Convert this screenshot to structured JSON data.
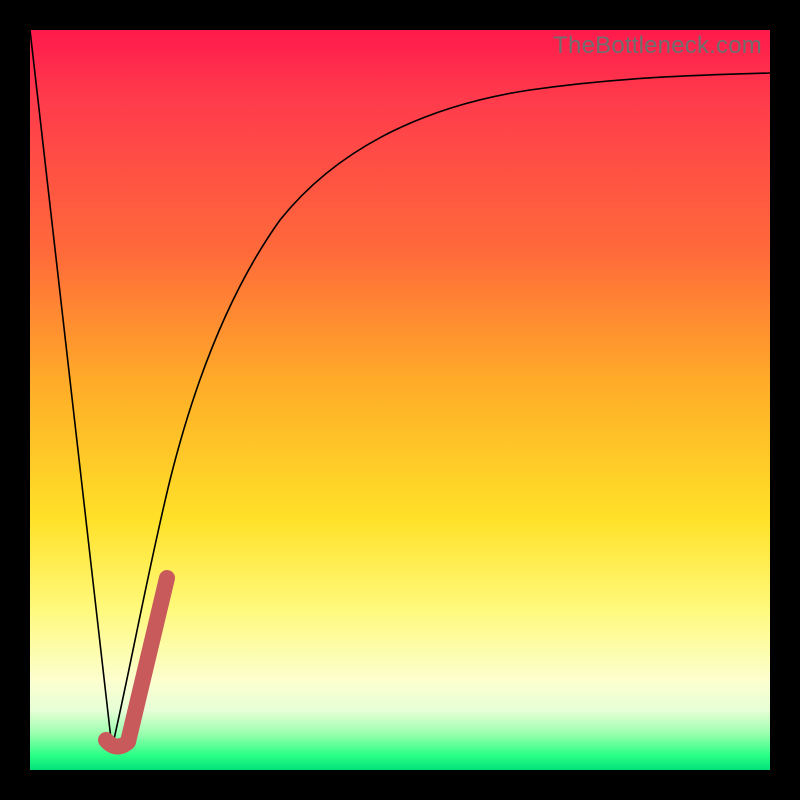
{
  "watermark": "TheBottleneck.com",
  "colors": {
    "frame": "#000000",
    "gradient_top": "#ff1a4c",
    "gradient_mid1": "#ff6a3a",
    "gradient_mid2": "#ffe128",
    "gradient_bottom": "#00e27a",
    "curve": "#000000",
    "highlight": "#c95a5c"
  },
  "chart_data": {
    "type": "line",
    "title": "",
    "xlabel": "",
    "ylabel": "",
    "xlim": [
      0,
      100
    ],
    "ylim": [
      0,
      100
    ],
    "grid": false,
    "legend": false,
    "series": [
      {
        "name": "left-falling-line",
        "x": [
          0,
          11
        ],
        "y": [
          100,
          3
        ]
      },
      {
        "name": "rising-saturating-curve",
        "x": [
          11,
          14,
          18,
          22,
          27,
          32,
          38,
          45,
          55,
          65,
          78,
          90,
          100
        ],
        "y": [
          3,
          15,
          30,
          43,
          55,
          64,
          72,
          78,
          83,
          86,
          88.5,
          89.5,
          90
        ]
      },
      {
        "name": "highlight-segment",
        "x": [
          10.5,
          12,
          15.5,
          18.5
        ],
        "y": [
          4,
          3,
          13,
          26
        ]
      }
    ]
  }
}
